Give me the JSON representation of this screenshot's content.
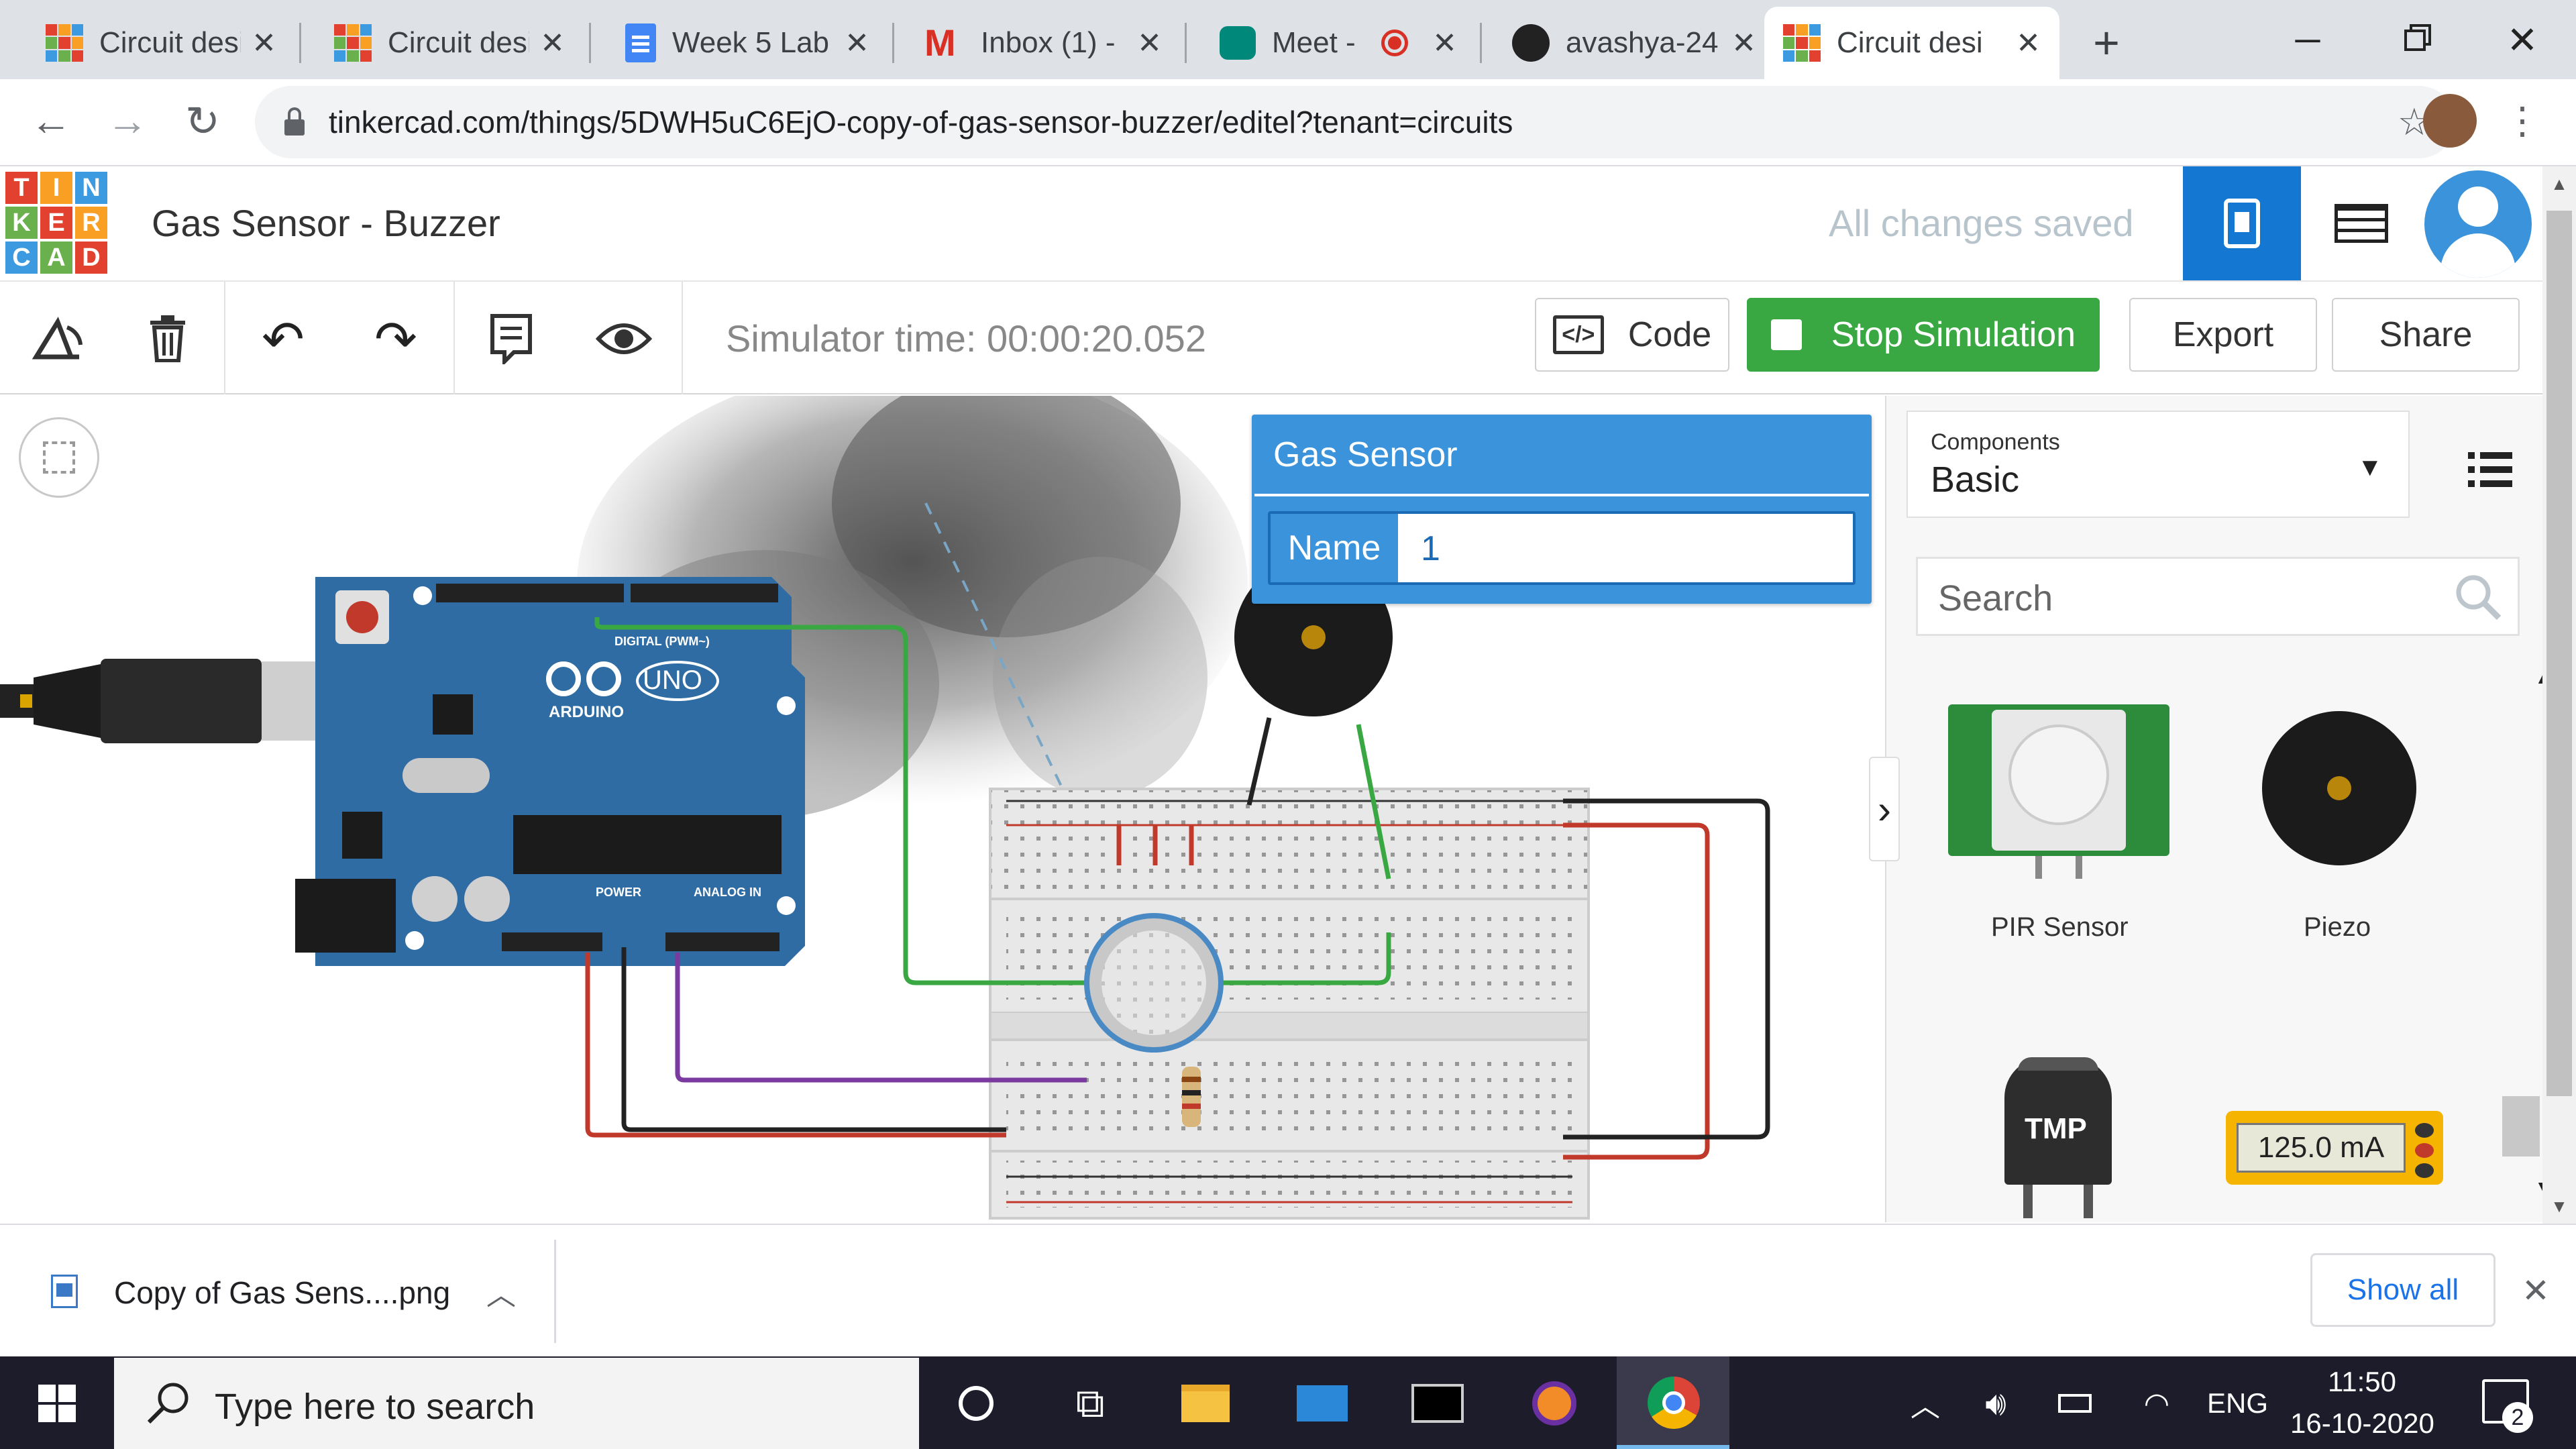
{
  "browser": {
    "tabs": [
      {
        "title": "Circuit desi",
        "icon": "tinkercad-icon"
      },
      {
        "title": "Circuit desi",
        "icon": "tinkercad-icon"
      },
      {
        "title": "Week 5 Lab",
        "icon": "google-docs-icon"
      },
      {
        "title": "Inbox (1) - ",
        "icon": "gmail-icon"
      },
      {
        "title": "Meet - ",
        "icon": "google-meet-icon"
      },
      {
        "title": "avashya-24",
        "icon": "github-icon"
      },
      {
        "title": "Circuit desi",
        "icon": "tinkercad-icon"
      }
    ],
    "url": "tinkercad.com/things/5DWH5uC6EjO-copy-of-gas-sensor-buzzer/editel?tenant=circuits"
  },
  "app": {
    "logo_letters": [
      "T",
      "I",
      "N",
      "K",
      "E",
      "R",
      "C",
      "A",
      "D"
    ],
    "project_title": "Gas Sensor - Buzzer",
    "save_status": "All changes saved"
  },
  "toolbar": {
    "sim_time": "Simulator time: 00:00:20.052",
    "code_label": "Code",
    "stop_label": "Stop Simulation",
    "export_label": "Export",
    "share_label": "Share"
  },
  "inspector": {
    "title": "Gas Sensor",
    "name_label": "Name",
    "name_value": "1"
  },
  "components": {
    "dropdown_caption": "Components",
    "dropdown_value": "Basic",
    "search_placeholder": "Search",
    "items": [
      {
        "label": "PIR Sensor"
      },
      {
        "label": "Piezo"
      },
      {
        "label": "TMP"
      },
      {
        "label": "125.0 mA"
      }
    ]
  },
  "circuit": {
    "arduino_brand": "ARDUINO",
    "arduino_model": "UNO",
    "digital_label": "DIGITAL (PWM~)",
    "power_label": "POWER",
    "analog_label": "ANALOG IN"
  },
  "download": {
    "file": "Copy of Gas Sens....png",
    "show_all": "Show all"
  },
  "taskbar": {
    "search_placeholder": "Type here to search",
    "lang": "ENG",
    "time": "11:50",
    "date": "16-10-2020",
    "notifications": "2"
  },
  "colors": {
    "tinkercad_blue": "#1477d1",
    "green": "#3aa842",
    "header_blue": "#3b93db",
    "arduino_blue": "#2f6ca4"
  }
}
